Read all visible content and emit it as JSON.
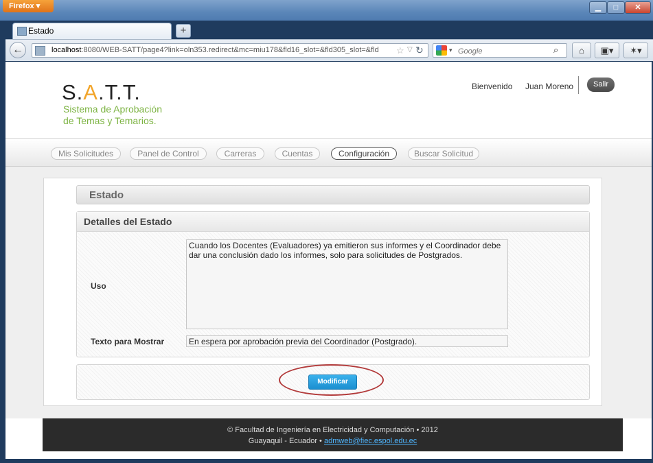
{
  "browser": {
    "app_button": "Firefox ▾",
    "tab_title": "Estado",
    "url_host": "localhost",
    "url_rest": ":8080/WEB-SATT/page4?link=oln353.redirect&mc=miu178&fld16_slot=&fld305_slot=&fld",
    "search_placeholder": "Google",
    "icons": [
      "back-arrow-icon",
      "favicon-icon",
      "star-icon",
      "reload-icon",
      "google-icon",
      "search-icon",
      "home-icon",
      "bookmarks-icon",
      "addon-icon"
    ]
  },
  "header": {
    "logo_start": "S.",
    "logo_accent": "A",
    "logo_end": ".T.T.",
    "tagline_line1": "Sistema de Aprobación",
    "tagline_line2": "de Temas y Temarios.",
    "greeting": "Bienvenido",
    "user_name": "Juan Moreno",
    "logout_label": "Salir"
  },
  "menu": {
    "items": [
      "Mis Solicitudes",
      "Panel de Control",
      "Carreras",
      "Cuentas",
      "Configuración",
      "Buscar Solicitud"
    ],
    "active": "Configuración"
  },
  "panel": {
    "title": "Estado",
    "section_title": "Detalles del Estado",
    "uso_label": "Uso",
    "uso_value": "Cuando los Docentes (Evaluadores) ya emitieron sus informes y el Coordinador debe dar una conclusión dado los informes, solo para solicitudes de Postgrados.",
    "texto_label": "Texto para Mostrar",
    "texto_value": "En espera por aprobación previa del Coordinador (Postgrado).",
    "modify_button": "Modificar"
  },
  "footer": {
    "line1": "© Facultad de Ingeniería en Electricidad y Computación • 2012",
    "line2_prefix": "Guayaquil - Ecuador • ",
    "email": "admweb@fiec.espol.edu.ec"
  },
  "colors": {
    "logo_accent": "#f2a52b",
    "tagline": "#7cb342",
    "primary_button": "#1b8fd0",
    "highlight_circle": "#b23a3a",
    "footer_bg": "#2b2b2b",
    "link": "#4fb6ff"
  }
}
